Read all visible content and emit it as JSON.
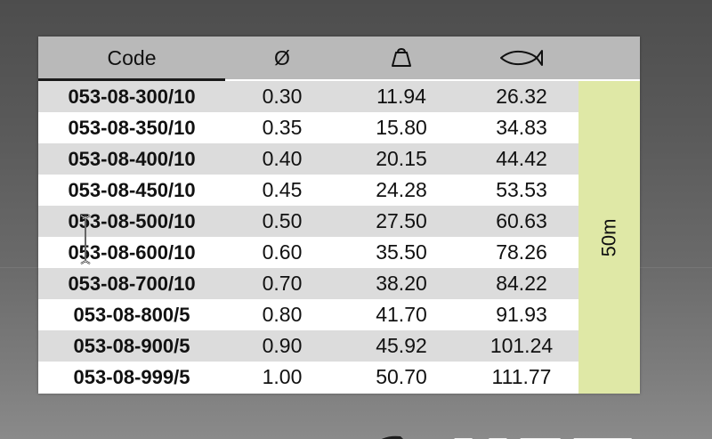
{
  "table": {
    "headers": {
      "code": "Code",
      "diameter": "Ø",
      "weight_icon": "weight-icon",
      "fish_icon": "fish-icon"
    },
    "rows": [
      {
        "code": "053-08-300/10",
        "diameter": "0.30",
        "weight": "11.94",
        "fish": "26.32"
      },
      {
        "code": "053-08-350/10",
        "diameter": "0.35",
        "weight": "15.80",
        "fish": "34.83"
      },
      {
        "code": "053-08-400/10",
        "diameter": "0.40",
        "weight": "20.15",
        "fish": "44.42"
      },
      {
        "code": "053-08-450/10",
        "diameter": "0.45",
        "weight": "24.28",
        "fish": "53.53"
      },
      {
        "code": "053-08-500/10",
        "diameter": "0.50",
        "weight": "27.50",
        "fish": "60.63"
      },
      {
        "code": "053-08-600/10",
        "diameter": "0.60",
        "weight": "35.50",
        "fish": "78.26"
      },
      {
        "code": "053-08-700/10",
        "diameter": "0.70",
        "weight": "38.20",
        "fish": "84.22"
      },
      {
        "code": "053-08-800/5",
        "diameter": "0.80",
        "weight": "41.70",
        "fish": "91.93"
      },
      {
        "code": "053-08-900/5",
        "diameter": "0.90",
        "weight": "45.92",
        "fish": "101.24"
      },
      {
        "code": "053-08-999/5",
        "diameter": "1.00",
        "weight": "50.70",
        "fish": "111.77"
      }
    ],
    "length": "50m"
  },
  "colors": {
    "header_bg": "#b9b9b9",
    "row_shade": "#dcdcdc",
    "row_plain": "#ffffff",
    "length_bg": "#dfe8a6"
  }
}
